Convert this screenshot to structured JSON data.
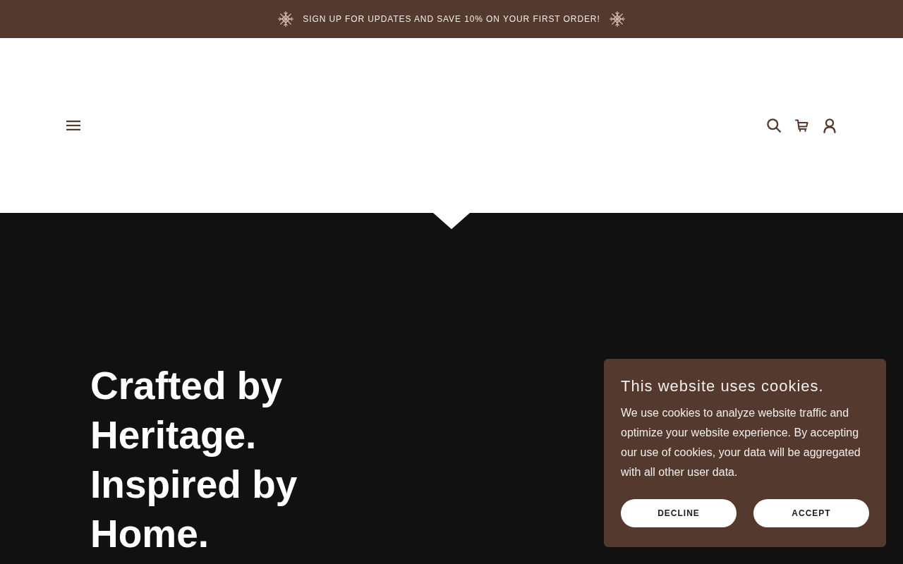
{
  "announcement_bar": {
    "text": "SIGN UP FOR UPDATES AND SAVE 10% ON YOUR FIRST ORDER!"
  },
  "hero": {
    "heading": "Crafted by Heritage. Inspired by Home."
  },
  "cookie_banner": {
    "title": "This website uses cookies.",
    "message": "We use cookies to analyze website traffic and optimize your website experience. By accepting our use of cookies, your data will be aggregated with all other user data.",
    "buttons": [
      "DECLINE",
      "ACCEPT"
    ]
  }
}
